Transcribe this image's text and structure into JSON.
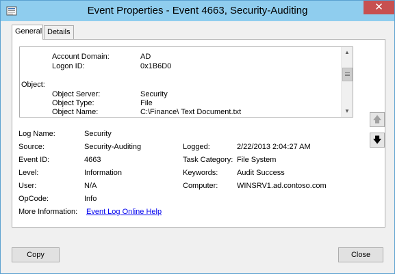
{
  "window": {
    "title": "Event Properties - Event 4663, Security-Auditing",
    "close_glyph": "✕"
  },
  "tabs": [
    {
      "label": "General",
      "active": true
    },
    {
      "label": "Details",
      "active": false
    }
  ],
  "description": {
    "lines": [
      {
        "label": "Account Domain:",
        "value": "AD"
      },
      {
        "label": "Logon ID:",
        "value": "0x1B6D0"
      },
      {
        "label": "Object:",
        "value": ""
      },
      {
        "label": "Object Server:",
        "value": "Security"
      },
      {
        "label": "Object Type:",
        "value": "File"
      },
      {
        "label": "Object Name:",
        "value": "C:\\Finance\\ Text Document.txt"
      }
    ]
  },
  "fields": {
    "log_name": {
      "label": "Log Name:",
      "value": "Security"
    },
    "source": {
      "label": "Source:",
      "value": "Security-Auditing"
    },
    "logged": {
      "label": "Logged:",
      "value": "2/22/2013 2:04:27 AM"
    },
    "event_id": {
      "label": "Event ID:",
      "value": "4663"
    },
    "task_category": {
      "label": "Task Category:",
      "value": "File System"
    },
    "level": {
      "label": "Level:",
      "value": "Information"
    },
    "keywords": {
      "label": "Keywords:",
      "value": "Audit Success"
    },
    "user": {
      "label": "User:",
      "value": "N/A"
    },
    "computer": {
      "label": "Computer:",
      "value": "WINSRV1.ad.contoso.com"
    },
    "opcode": {
      "label": "OpCode:",
      "value": "Info"
    },
    "more_info": {
      "label": "More Information:",
      "value": "Event Log Online Help"
    }
  },
  "nav": {
    "up_glyph": "🡅",
    "down_glyph": "🡇"
  },
  "buttons": {
    "copy": "Copy",
    "close": "Close"
  },
  "colors": {
    "titlebar": "#8fcdee",
    "close_button": "#c75050",
    "link": "#0000ee"
  }
}
